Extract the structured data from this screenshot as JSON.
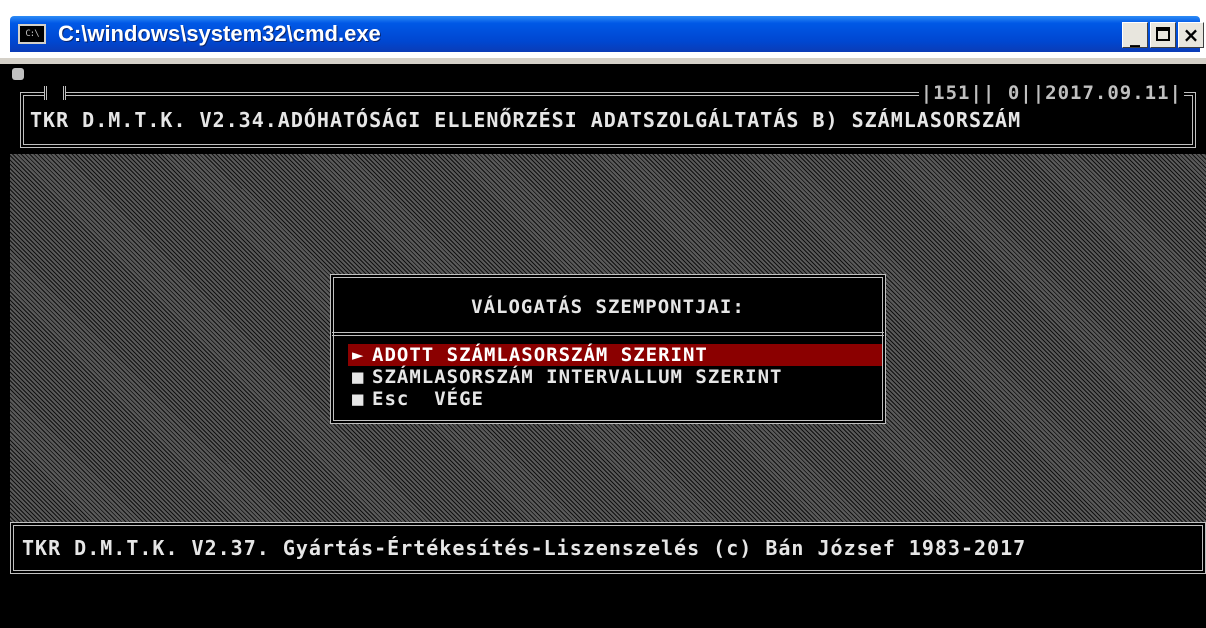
{
  "window": {
    "title": "C:\\windows\\system32\\cmd.exe",
    "icon_label": "C:\\",
    "controls": {
      "minimize": "_",
      "close": "×"
    }
  },
  "header": {
    "status": "151",
    "counter": "0",
    "date": "2017.09.11",
    "title": "TKR D.M.T.K. V2.34.ADÓHATÓSÁGI ELLENŐRZÉSI ADATSZOLGÁLTATÁS B) SZÁMLASORSZÁM"
  },
  "dialog": {
    "title": "VÁLOGATÁS SZEMPONTJAI:",
    "items": [
      {
        "bullet": "►",
        "label": "ADOTT SZÁMLASORSZÁM SZERINT",
        "selected": true
      },
      {
        "bullet": "■",
        "label": "SZÁMLASORSZÁM INTERVALLUM SZERINT",
        "selected": false
      },
      {
        "bullet": "■",
        "label": "Esc  VÉGE",
        "selected": false
      }
    ]
  },
  "footer": {
    "text": "TKR D.M.T.K. V2.37. Gyártás-Értékesítés-Liszenszelés (c) Bán József 1983-2017"
  },
  "colors": {
    "console_bg": "#000000",
    "console_fg": "#c0c0c0",
    "selection": "#8b0000",
    "titlebar": "#0058e6"
  }
}
